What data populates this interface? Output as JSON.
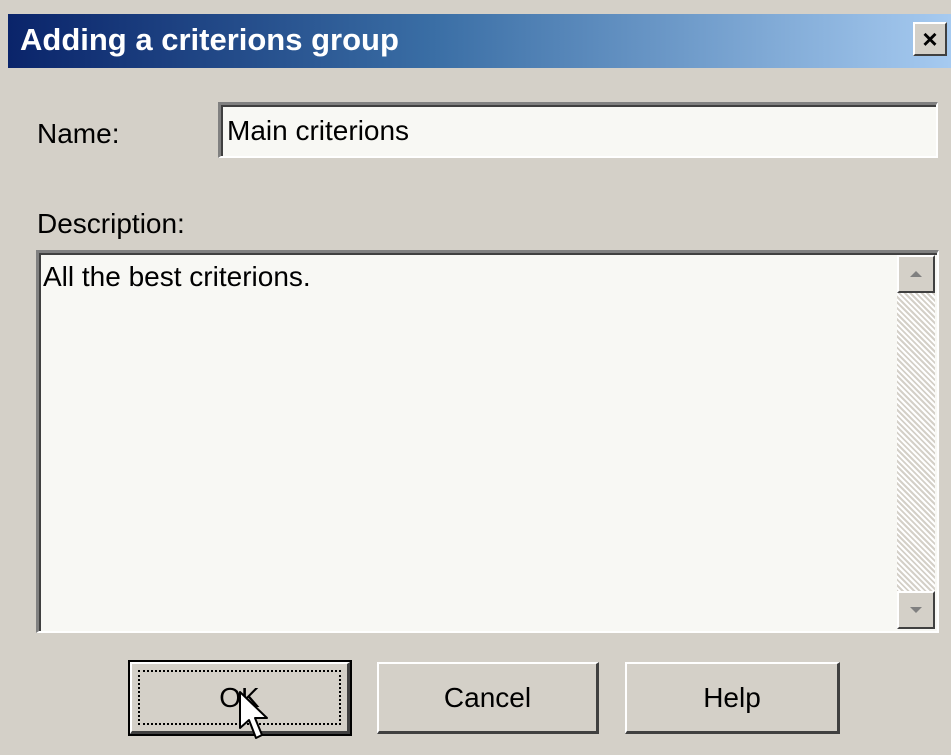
{
  "dialog": {
    "title": "Adding a criterions group",
    "close_label": "×"
  },
  "form": {
    "name_label": "Name:",
    "name_value": "Main criterions",
    "description_label": "Description:",
    "description_value": "All the best criterions."
  },
  "buttons": {
    "ok_label": "OK",
    "cancel_label": "Cancel",
    "help_label": "Help"
  },
  "icons": {
    "close": "close-icon",
    "scroll_up": "scroll-up-arrow-icon",
    "scroll_down": "scroll-down-arrow-icon",
    "cursor": "mouse-pointer-icon"
  },
  "colors": {
    "title_gradient_start": "#0a246a",
    "title_gradient_end": "#a6caf0",
    "dialog_background": "#d4d0c8"
  }
}
